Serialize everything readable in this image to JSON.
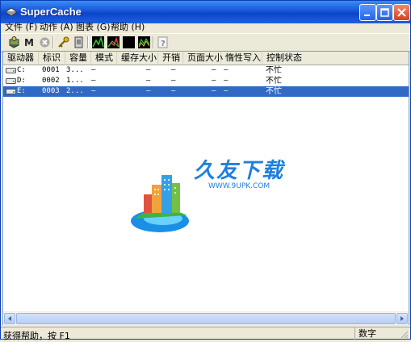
{
  "window": {
    "title": "SuperCache"
  },
  "menu": [
    {
      "label": "文件 (F)"
    },
    {
      "label": "动作 (A)"
    },
    {
      "label": "图表 (G)"
    },
    {
      "label": "帮助 (H)"
    }
  ],
  "toolbar": {
    "icons": [
      "refresh-icon",
      "m-letter-icon",
      "stop-icon",
      "key-icon",
      "file-icon",
      "chart-green-icon",
      "chart-red-icon",
      "black-square-icon",
      "chart-multi-icon",
      "help-icon"
    ]
  },
  "table": {
    "columns": [
      "驱动器",
      "标识",
      "容量",
      "模式",
      "缓存大小",
      "开销",
      "页面大小",
      "惰性写入",
      "控制状态"
    ],
    "rows": [
      {
        "drive": "C:",
        "id": "0001",
        "size": "3...",
        "mode": "–",
        "cache": "–",
        "overhead": "–",
        "page": "–",
        "lazy": "–",
        "status": "不忙",
        "selected": false
      },
      {
        "drive": "D:",
        "id": "0002",
        "size": "1...",
        "mode": "–",
        "cache": "–",
        "overhead": "–",
        "page": "–",
        "lazy": "–",
        "status": "不忙",
        "selected": false
      },
      {
        "drive": "E:",
        "id": "0003",
        "size": "2...",
        "mode": "–",
        "cache": "–",
        "overhead": "–",
        "page": "–",
        "lazy": "–",
        "status": "不忙",
        "selected": true
      }
    ]
  },
  "watermark": {
    "cn": "久友下载",
    "url": "WWW.9UPK.COM"
  },
  "status": {
    "help": "获得帮助，按 F1",
    "numlock": "数字"
  },
  "colors": {
    "selection": "#316ac5",
    "titlebar": "#0c45c8",
    "face": "#ece9d8"
  }
}
